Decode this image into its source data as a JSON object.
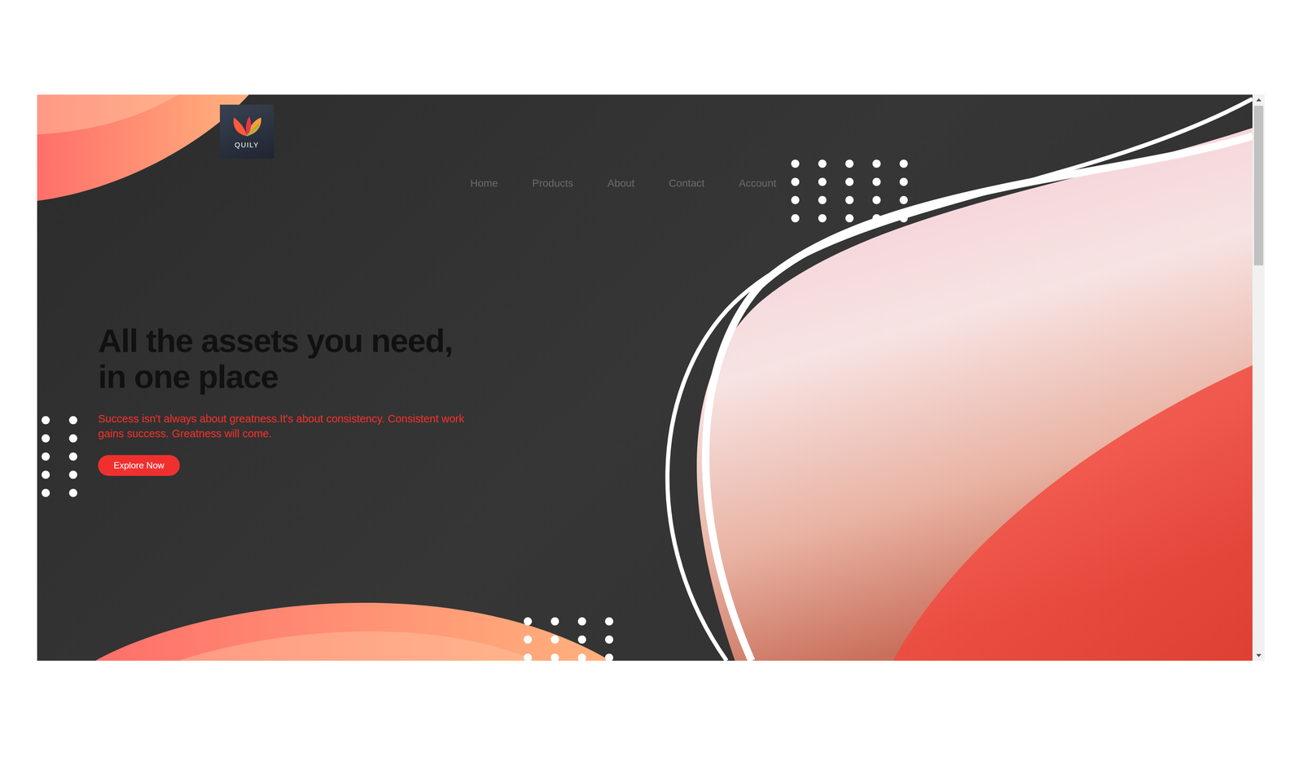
{
  "logo": {
    "text": "QUILY"
  },
  "nav": {
    "items": [
      {
        "label": "Home"
      },
      {
        "label": "Products"
      },
      {
        "label": "About"
      },
      {
        "label": "Contact"
      },
      {
        "label": "Account"
      }
    ]
  },
  "hero": {
    "heading": [
      "All the assets you need,",
      "in one place"
    ],
    "text": "Success isn't always about greatness.It's about consistency. Consistent work gains success. Greatness will come.",
    "button": "Explore Now"
  }
}
